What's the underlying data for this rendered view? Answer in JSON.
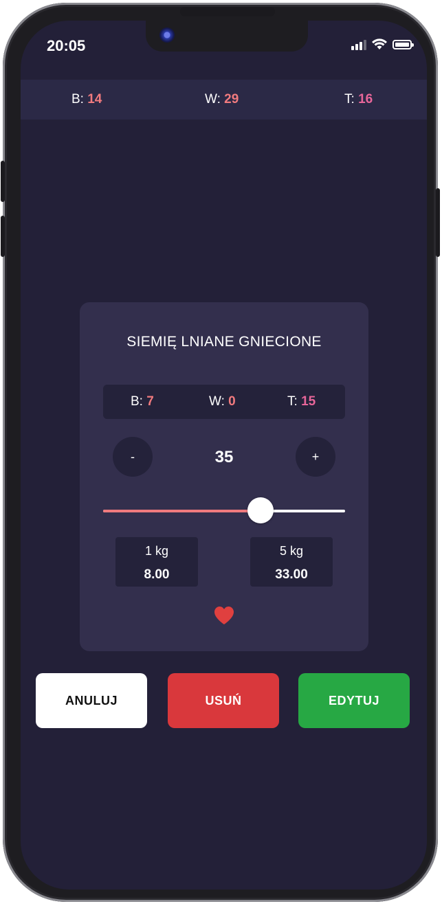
{
  "status_bar": {
    "time": "20:05"
  },
  "daily_totals": {
    "b_label": "B:",
    "b_value": "14",
    "w_label": "W:",
    "w_value": "29",
    "t_label": "T:",
    "t_value": "16"
  },
  "product_card": {
    "title": "SIEMIĘ LNIANE GNIECIONE",
    "macros": {
      "b_label": "B:",
      "b_value": "7",
      "w_label": "W:",
      "w_value": "0",
      "t_label": "T:",
      "t_value": "15"
    },
    "decrement_label": "-",
    "increment_label": "+",
    "amount": "35",
    "slider_fraction": 0.65,
    "price_left": {
      "label": "1 kg",
      "value": "8.00"
    },
    "price_right": {
      "label": "5 kg",
      "value": "33.00"
    },
    "favorite_icon": "heart-icon"
  },
  "actions": {
    "cancel_label": "ANULUJ",
    "delete_label": "USUŃ",
    "edit_label": "EDYTUJ"
  },
  "colors": {
    "accent": "#f07a7e",
    "screen_bg": "#232038",
    "card_bg": "#332f4d",
    "delete": "#d9383c",
    "edit": "#27a844",
    "heart": "#e0403f"
  }
}
